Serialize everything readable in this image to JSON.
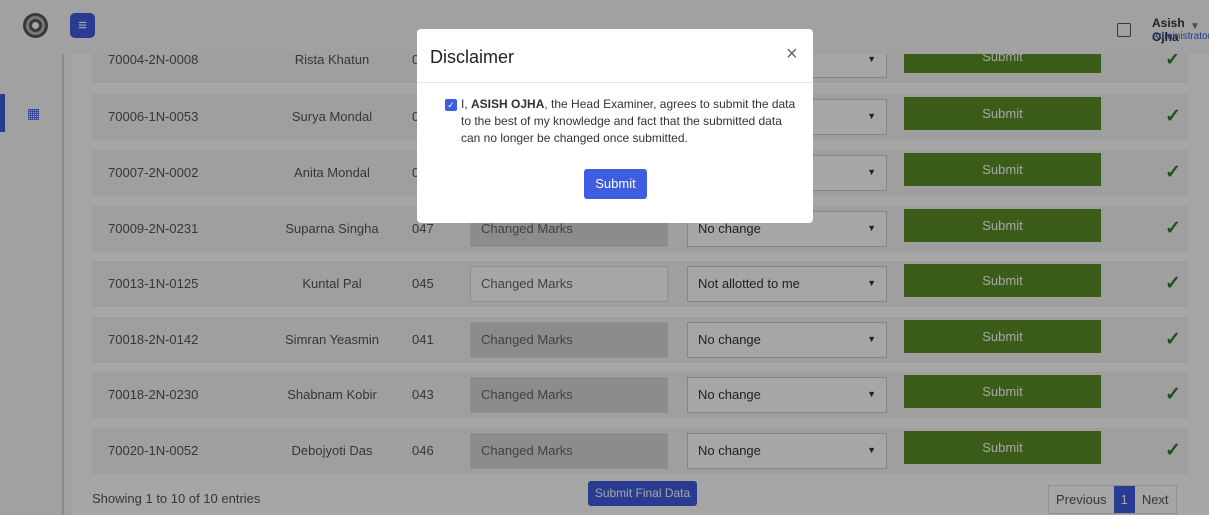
{
  "user": {
    "name": "Asish Ojha",
    "role": "Administrator"
  },
  "rows": [
    {
      "roll": "70004-2N-0008",
      "name": "Rista Khatun",
      "code": "0",
      "marks": "",
      "status": "",
      "submit": "Submit"
    },
    {
      "roll": "70006-1N-0053",
      "name": "Surya Mondal",
      "code": "0",
      "marks": "",
      "status": "",
      "submit": "Submit"
    },
    {
      "roll": "70007-2N-0002",
      "name": "Anita Mondal",
      "code": "0",
      "marks": "",
      "status": "",
      "submit": "Submit"
    },
    {
      "roll": "70009-2N-0231",
      "name": "Suparna Singha",
      "code": "047",
      "marks": "Changed Marks",
      "status": "No change",
      "submit": "Submit"
    },
    {
      "roll": "70013-1N-0125",
      "name": "Kuntal Pal",
      "code": "045",
      "marks": "Changed Marks",
      "status": "Not allotted to me",
      "submit": "Submit"
    },
    {
      "roll": "70018-2N-0142",
      "name": "Simran Yeasmin",
      "code": "041",
      "marks": "Changed Marks",
      "status": "No change",
      "submit": "Submit"
    },
    {
      "roll": "70018-2N-0230",
      "name": "Shabnam Kobir",
      "code": "043",
      "marks": "Changed Marks",
      "status": "No change",
      "submit": "Submit"
    },
    {
      "roll": "70020-1N-0052",
      "name": "Debojyoti Das",
      "code": "046",
      "marks": "Changed Marks",
      "status": "No change",
      "submit": "Submit"
    }
  ],
  "footer": {
    "info": "Showing 1 to 10 of 10 entries",
    "final": "Submit Final Data",
    "prev": "Previous",
    "page": "1",
    "next": "Next"
  },
  "modal": {
    "title": "Disclaimer",
    "close": "×",
    "pre": "I, ",
    "bold": "ASISH OJHA",
    "l1": ", the Head Examiner, agrees to submit the data",
    "l2": "to the best of my knowledge and fact that the submitted data",
    "l3": "can no longer be changed once submitted.",
    "submit": "Submit"
  }
}
